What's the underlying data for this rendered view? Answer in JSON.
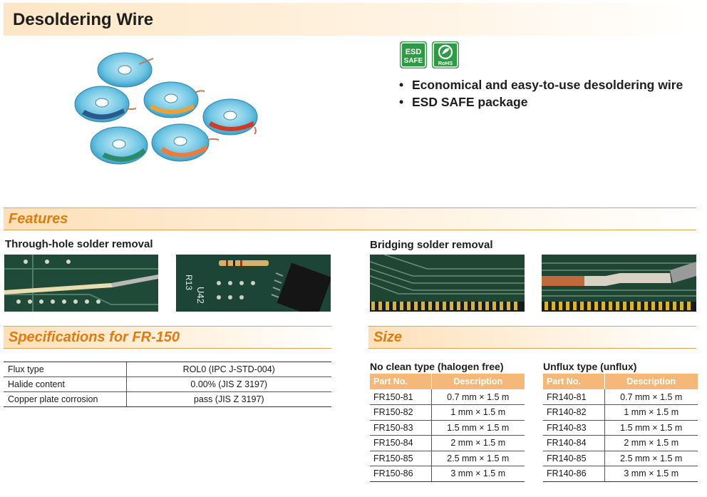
{
  "header": {
    "title": "Desoldering Wire"
  },
  "badges": {
    "esd_line1": "ESD",
    "esd_line2": "SAFE",
    "rohs": "RoHS"
  },
  "bullets": [
    "Economical and easy-to-use desoldering wire",
    "ESD SAFE package"
  ],
  "bullet_symbol": "•",
  "features": {
    "title": "Features",
    "through_hole": "Through-hole solder removal",
    "bridging": "Bridging solder removal",
    "photo_label_r13": "R13",
    "photo_label_u42": "U42"
  },
  "specs": {
    "title": "Specifications for FR-150",
    "rows": [
      {
        "label": "Flux type",
        "value": "ROL0 (IPC J-STD-004)"
      },
      {
        "label": "Halide content",
        "value": "0.00% (JIS Z 3197)"
      },
      {
        "label": "Copper plate corrosion",
        "value": "pass (JIS Z 3197)"
      }
    ]
  },
  "size": {
    "title": "Size",
    "no_clean": {
      "heading": "No clean type (halogen free)",
      "col_part": "Part No.",
      "col_desc": "Description",
      "rows": [
        {
          "part": "FR150-81",
          "desc": "0.7 mm × 1.5 m"
        },
        {
          "part": "FR150-82",
          "desc": "1 mm × 1.5 m"
        },
        {
          "part": "FR150-83",
          "desc": "1.5 mm × 1.5 m"
        },
        {
          "part": "FR150-84",
          "desc": "2 mm × 1.5 m"
        },
        {
          "part": "FR150-85",
          "desc": "2.5 mm × 1.5 m"
        },
        {
          "part": "FR150-86",
          "desc": "3 mm × 1.5 m"
        }
      ]
    },
    "unflux": {
      "heading": "Unflux type (unflux)",
      "col_part": "Part No.",
      "col_desc": "Description",
      "rows": [
        {
          "part": "FR140-81",
          "desc": "0.7 mm × 1.5 m"
        },
        {
          "part": "FR140-82",
          "desc": "1 mm × 1.5 m"
        },
        {
          "part": "FR140-83",
          "desc": "1.5 mm × 1.5 m"
        },
        {
          "part": "FR140-84",
          "desc": "2 mm × 1.5 m"
        },
        {
          "part": "FR140-85",
          "desc": "2.5 mm × 1.5 m"
        },
        {
          "part": "FR140-86",
          "desc": "3 mm × 1.5 m"
        }
      ]
    }
  },
  "colors": {
    "accent_orange": "#e07b10",
    "header_fill": "#f5b878",
    "badge_green": "#2e9a45",
    "pcb_green": "#1f4a3a"
  }
}
